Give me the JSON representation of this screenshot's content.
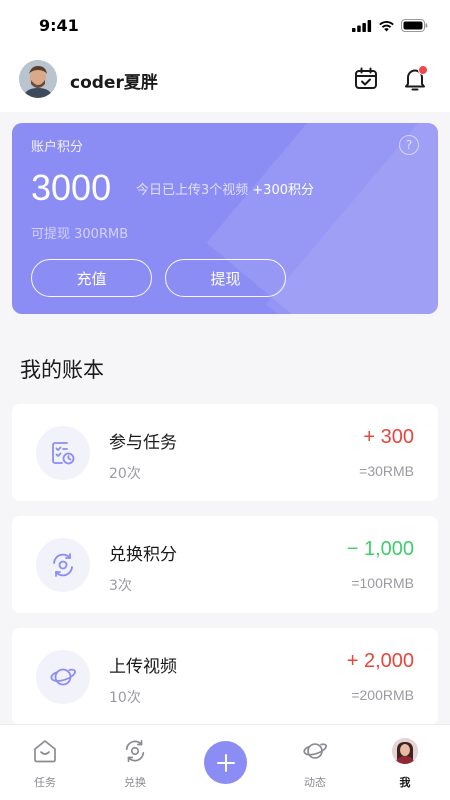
{
  "status_bar": {
    "time": "9:41"
  },
  "header": {
    "username": "coder夏胖"
  },
  "points_card": {
    "label": "账户积分",
    "points": "3000",
    "today_text": "今日已上传3个视频",
    "today_bonus": "+300积分",
    "withdrawable": "可提现 300RMB",
    "recharge_label": "充值",
    "withdraw_label": "提现"
  },
  "ledger": {
    "title": "我的账本",
    "items": [
      {
        "title": "参与任务",
        "count": "20次",
        "amount": "+ 300",
        "rmb": "=30RMB",
        "icon": "task-list-icon",
        "amount_color": "#e8453c"
      },
      {
        "title": "兑换积分",
        "count": "3次",
        "amount": "− 1,000",
        "rmb": "=100RMB",
        "icon": "exchange-icon",
        "amount_color": "#3fcf6a"
      },
      {
        "title": "上传视频",
        "count": "10次",
        "amount": "+ 2,000",
        "rmb": "=200RMB",
        "icon": "planet-icon",
        "amount_color": "#e8453c"
      }
    ]
  },
  "tab_bar": {
    "tabs": [
      {
        "label": "任务",
        "icon": "home-task-icon"
      },
      {
        "label": "兑换",
        "icon": "exchange-icon"
      },
      {
        "label": "",
        "icon": "plus-icon"
      },
      {
        "label": "动态",
        "icon": "planet-icon"
      },
      {
        "label": "我",
        "icon": "avatar"
      }
    ]
  },
  "colors": {
    "accent": "#8c8cf5",
    "positive": "#e8453c",
    "negative": "#3fcf6a"
  }
}
